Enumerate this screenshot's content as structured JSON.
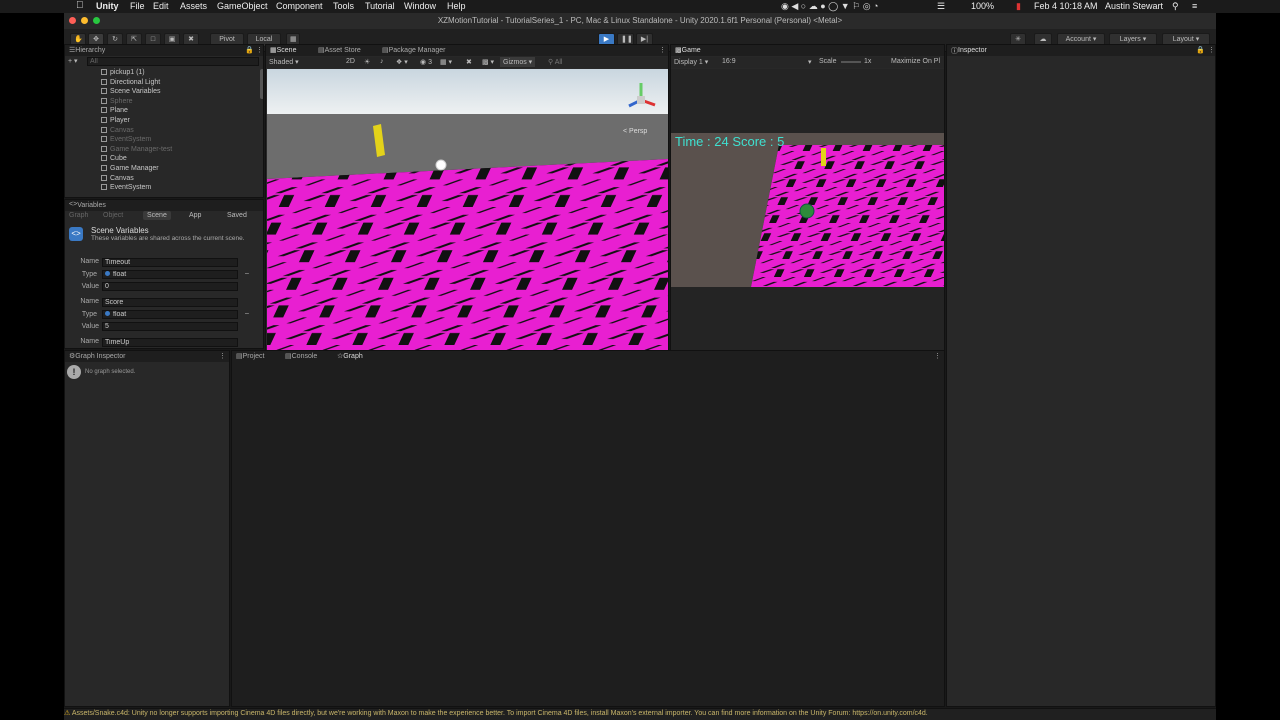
{
  "menubar": {
    "app": "Unity",
    "items": [
      "File",
      "Edit",
      "Assets",
      "GameObject",
      "Component",
      "Tools",
      "Tutorial",
      "Window",
      "Help"
    ],
    "battery": "100%",
    "datetime": "Feb 4  10:18 AM",
    "user": "Austin Stewart"
  },
  "window": {
    "title": "XZMotionTutorial - TutorialSeries_1 - PC, Mac & Linux Standalone - Unity 2020.1.6f1 Personal (Personal) <Metal>"
  },
  "toolbar": {
    "pivot": "Pivot",
    "local": "Local",
    "account": "Account",
    "layers": "Layers",
    "layout": "Layout"
  },
  "hierarchy": {
    "tab": "Hierarchy",
    "search_placeholder": "All",
    "items": [
      {
        "label": "pickup1 (1)",
        "dim": false
      },
      {
        "label": "Directional Light",
        "dim": false
      },
      {
        "label": "Scene Variables",
        "dim": false
      },
      {
        "label": "Sphere",
        "dim": true
      },
      {
        "label": "Plane",
        "dim": false
      },
      {
        "label": "Player",
        "dim": false
      },
      {
        "label": "Canvas",
        "dim": true
      },
      {
        "label": "EventSystem",
        "dim": true
      },
      {
        "label": "Game Manager-test",
        "dim": true
      },
      {
        "label": "Cube",
        "dim": false
      },
      {
        "label": "Game Manager",
        "dim": false
      },
      {
        "label": "Canvas",
        "dim": false
      },
      {
        "label": "EventSystem",
        "dim": false
      }
    ]
  },
  "variables": {
    "tab": "Variables",
    "subtabs": [
      "Graph",
      "Object",
      "Scene",
      "App",
      "Saved"
    ],
    "header_title": "Scene Variables",
    "header_desc": "These variables are shared across the current scene.",
    "labels": {
      "name": "Name",
      "type": "Type",
      "value": "Value"
    },
    "entries": [
      {
        "name": "Timeout",
        "type": "float",
        "value": "0"
      },
      {
        "name": "Score",
        "type": "float",
        "value": "5"
      },
      {
        "name": "TimeUp",
        "type": "",
        "value": ""
      }
    ]
  },
  "scene": {
    "tabs": [
      "Scene",
      "Asset Store",
      "Package Manager"
    ],
    "shading": "Shaded",
    "mode2d": "2D",
    "gizmos": "Gizmos",
    "search_placeholder": "All",
    "persp": "< Persp",
    "layer_count": "3"
  },
  "game": {
    "tab": "Game",
    "display": "Display 1",
    "aspect": "16:9",
    "scale_label": "Scale",
    "scale_value": "1x",
    "maximize": "Maximize On Pl",
    "hud": "Time : 24 Score : 5"
  },
  "inspector": {
    "tab": "Inspector"
  },
  "graph_inspector": {
    "tab": "Graph Inspector",
    "message": "No graph selected."
  },
  "bottom_tabs": [
    "Project",
    "Console",
    "Graph"
  ],
  "status": {
    "message": "Assets/Snake.c4d: Unity no longer supports importing Cinema 4D files directly, but we're working with Maxon to make the experience better. To import Cinema 4D files, install Maxon's external importer. You can find more information on the Unity Forum: https://on.unity.com/c4d."
  },
  "colors": {
    "magenta": "#e81fd1",
    "hud": "#3fe0d0",
    "accent": "#3a79c4"
  }
}
